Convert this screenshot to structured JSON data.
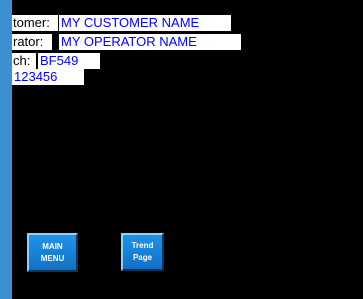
{
  "fields": {
    "customer": {
      "label": "tomer:",
      "value": "MY CUSTOMER NAME"
    },
    "operator": {
      "label": "rator:",
      "value": "MY OPERATOR NAME"
    },
    "batch": {
      "label": "ch:",
      "value": "BF549"
    },
    "number": {
      "value": "123456"
    }
  },
  "buttons": {
    "main_menu": {
      "line1": "MAIN",
      "line2": "MENU"
    },
    "trend_page": {
      "line1": "Trend",
      "line2": "Page"
    }
  },
  "colors": {
    "background": "#000000",
    "sidebar": "#3c8fd0",
    "field_text": "#0000ff",
    "button": "#1b86db"
  }
}
